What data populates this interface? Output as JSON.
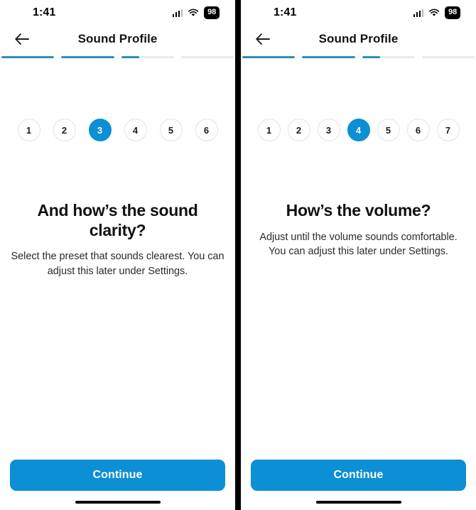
{
  "theme": {
    "accent": "#0c8fd4",
    "progress_fill": "#2f8fb8",
    "progress_track": "#e9e9e9",
    "step_border": "#e3e3e5",
    "text_primary": "#111111",
    "text_secondary": "#2c2c2e",
    "gutter": "#000000"
  },
  "panels": [
    {
      "status": {
        "time": "1:41",
        "battery": "98",
        "signal_icon": "cellular-bars-icon",
        "wifi_icon": "wifi-icon",
        "battery_icon": "battery-pill-icon"
      },
      "nav": {
        "back_icon": "arrow-left-icon",
        "title": "Sound Profile"
      },
      "progress": {
        "segments": [
          100,
          100,
          35,
          0
        ]
      },
      "steps": {
        "labels": [
          "1",
          "2",
          "3",
          "4",
          "5",
          "6"
        ],
        "active": "3"
      },
      "copy": {
        "headline": "And how’s the sound clarity?",
        "subhead": "Select the preset that sounds clearest. You can adjust this later under Settings."
      },
      "footer": {
        "cta_label": "Continue",
        "home_indicator": "home-indicator"
      }
    },
    {
      "status": {
        "time": "1:41",
        "battery": "98",
        "signal_icon": "cellular-bars-icon",
        "wifi_icon": "wifi-icon",
        "battery_icon": "battery-pill-icon"
      },
      "nav": {
        "back_icon": "arrow-left-icon",
        "title": "Sound Profile"
      },
      "progress": {
        "segments": [
          100,
          100,
          35,
          0
        ]
      },
      "steps": {
        "labels": [
          "1",
          "2",
          "3",
          "4",
          "5",
          "6",
          "7"
        ],
        "active": "4"
      },
      "copy": {
        "headline": "How’s the volume?",
        "subhead": "Adjust until the volume sounds comfortable.\nYou can adjust this later under Settings."
      },
      "footer": {
        "cta_label": "Continue",
        "home_indicator": "home-indicator"
      }
    }
  ]
}
